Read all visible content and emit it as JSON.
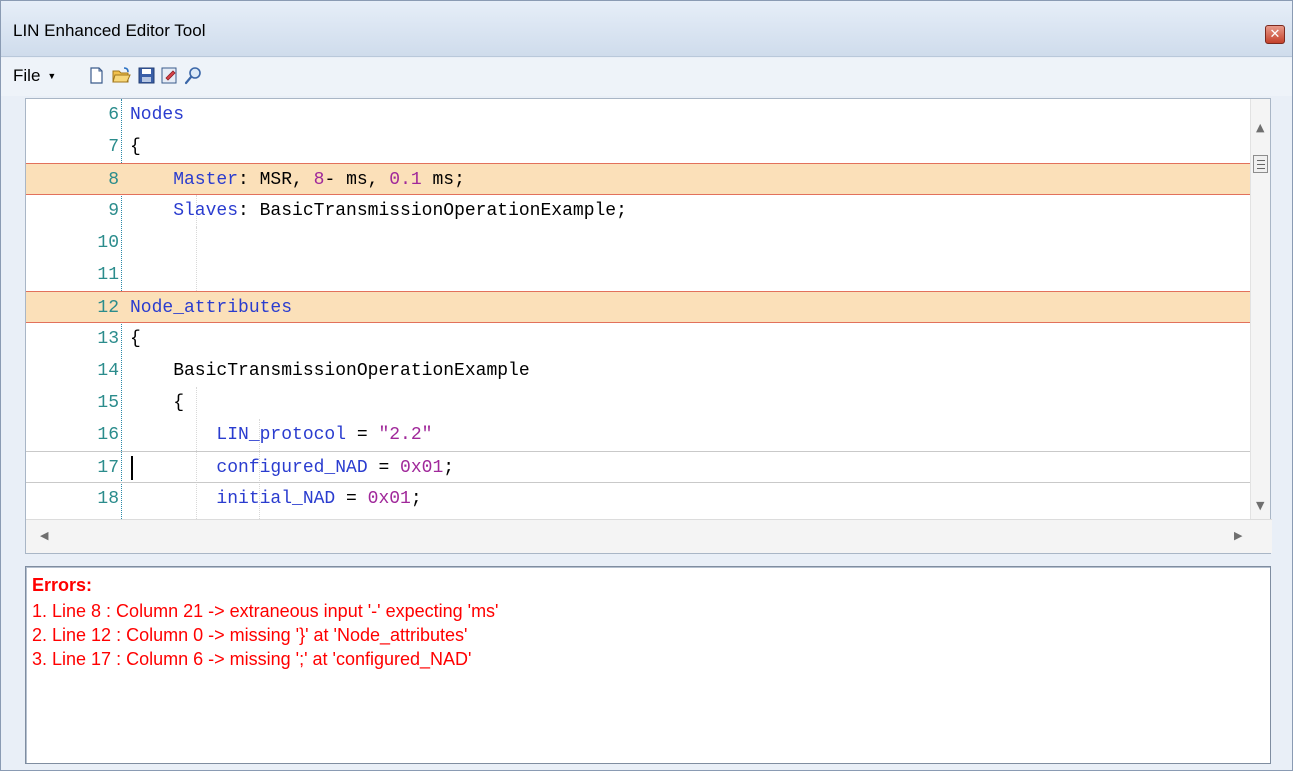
{
  "window": {
    "title": "LIN Enhanced Editor Tool",
    "close_glyph": "✕"
  },
  "toolbar": {
    "file_label": "File",
    "icons": [
      "new-file-icon",
      "open-folder-icon",
      "save-icon",
      "save-as-icon",
      "search-icon"
    ]
  },
  "editor": {
    "lines": [
      {
        "num": "6",
        "text": "Nodes"
      },
      {
        "num": "7",
        "text": "{"
      },
      {
        "num": "8",
        "text": "    Master: MSR, 8- ms, 0.1 ms;"
      },
      {
        "num": "9",
        "text": "    Slaves: BasicTransmissionOperationExample;"
      },
      {
        "num": "10",
        "text": ""
      },
      {
        "num": "11",
        "text": ""
      },
      {
        "num": "12",
        "text": "Node_attributes"
      },
      {
        "num": "13",
        "text": "{"
      },
      {
        "num": "14",
        "text": "    BasicTransmissionOperationExample"
      },
      {
        "num": "15",
        "text": "    {"
      },
      {
        "num": "16",
        "text": "        LIN_protocol = \"2.2\""
      },
      {
        "num": "17",
        "text": "        configured_NAD = 0x01;"
      },
      {
        "num": "18",
        "text": "        initial_NAD = 0x01;"
      }
    ],
    "error_lines": [
      "8",
      "12"
    ],
    "current_line": "17"
  },
  "errors": {
    "title": "Errors:",
    "items": [
      "1. Line 8 : Column 21 -> extraneous input '-' expecting 'ms'",
      "2. Line 12 : Column 0 -> missing '}' at 'Node_attributes'",
      "3. Line 17 : Column 6 -> missing ';' at 'configured_NAD'"
    ]
  },
  "colors": {
    "keyword": "#2a3ccf",
    "number": "#a0289a",
    "line_number": "#2b8c8c",
    "error_line_bg": "#fbe0b9",
    "error_text": "#ff0000"
  }
}
